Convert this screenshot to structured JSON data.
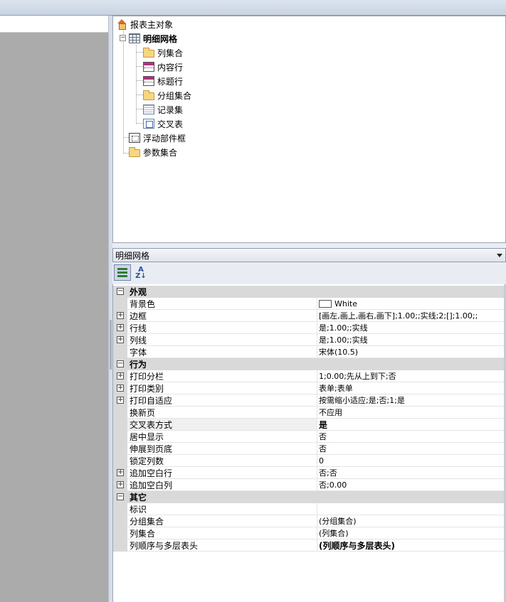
{
  "tree": {
    "root": "报表主对象",
    "detail_grid": "明细网格",
    "children": [
      {
        "label": "列集合",
        "icon": "folder-icon"
      },
      {
        "label": "内容行",
        "icon": "row-icon"
      },
      {
        "label": "标题行",
        "icon": "row-icon"
      },
      {
        "label": "分组集合",
        "icon": "folder-icon"
      },
      {
        "label": "记录集",
        "icon": "recordset-icon"
      },
      {
        "label": "交叉表",
        "icon": "crosstab-icon"
      }
    ],
    "floating": "浮动部件框",
    "params": "参数集合"
  },
  "object_selector": {
    "value": "明细网格"
  },
  "property_grid": {
    "categories": {
      "appearance": "外观",
      "behavior": "行为",
      "other": "其它"
    },
    "appearance": [
      {
        "name": "背景色",
        "value": "White"
      },
      {
        "name": "边框",
        "value": "[画左,画上,画右,画下];1.00;;实线;2;[];1.00;;"
      },
      {
        "name": "行线",
        "value": "是;1.00;;实线"
      },
      {
        "name": "列线",
        "value": "是;1.00;;实线"
      },
      {
        "name": "字体",
        "value": "宋体(10.5)"
      }
    ],
    "behavior": [
      {
        "name": "打印分栏",
        "value": "1;0.00;先从上到下;否"
      },
      {
        "name": "打印类别",
        "value": "表单;表单"
      },
      {
        "name": "打印自适应",
        "value": "按需缩小适应;是;否;1;是"
      },
      {
        "name": "换新页",
        "value": "不应用"
      },
      {
        "name": "交叉表方式",
        "value": "是"
      },
      {
        "name": "居中显示",
        "value": "否"
      },
      {
        "name": "伸展到页底",
        "value": "否"
      },
      {
        "name": "锁定列数",
        "value": "0"
      },
      {
        "name": "追加空白行",
        "value": "否;否"
      },
      {
        "name": "追加空白列",
        "value": "否;0.00"
      }
    ],
    "other": [
      {
        "name": "标识",
        "value": ""
      },
      {
        "name": "分组集合",
        "value": "(分组集合)"
      },
      {
        "name": "列集合",
        "value": "(列集合)"
      },
      {
        "name": "列顺序与多层表头",
        "value": "(列顺序与多层表头)"
      }
    ]
  },
  "colors": {
    "background_swatch": "#ffffff",
    "category_band": "#d9d9d9"
  }
}
